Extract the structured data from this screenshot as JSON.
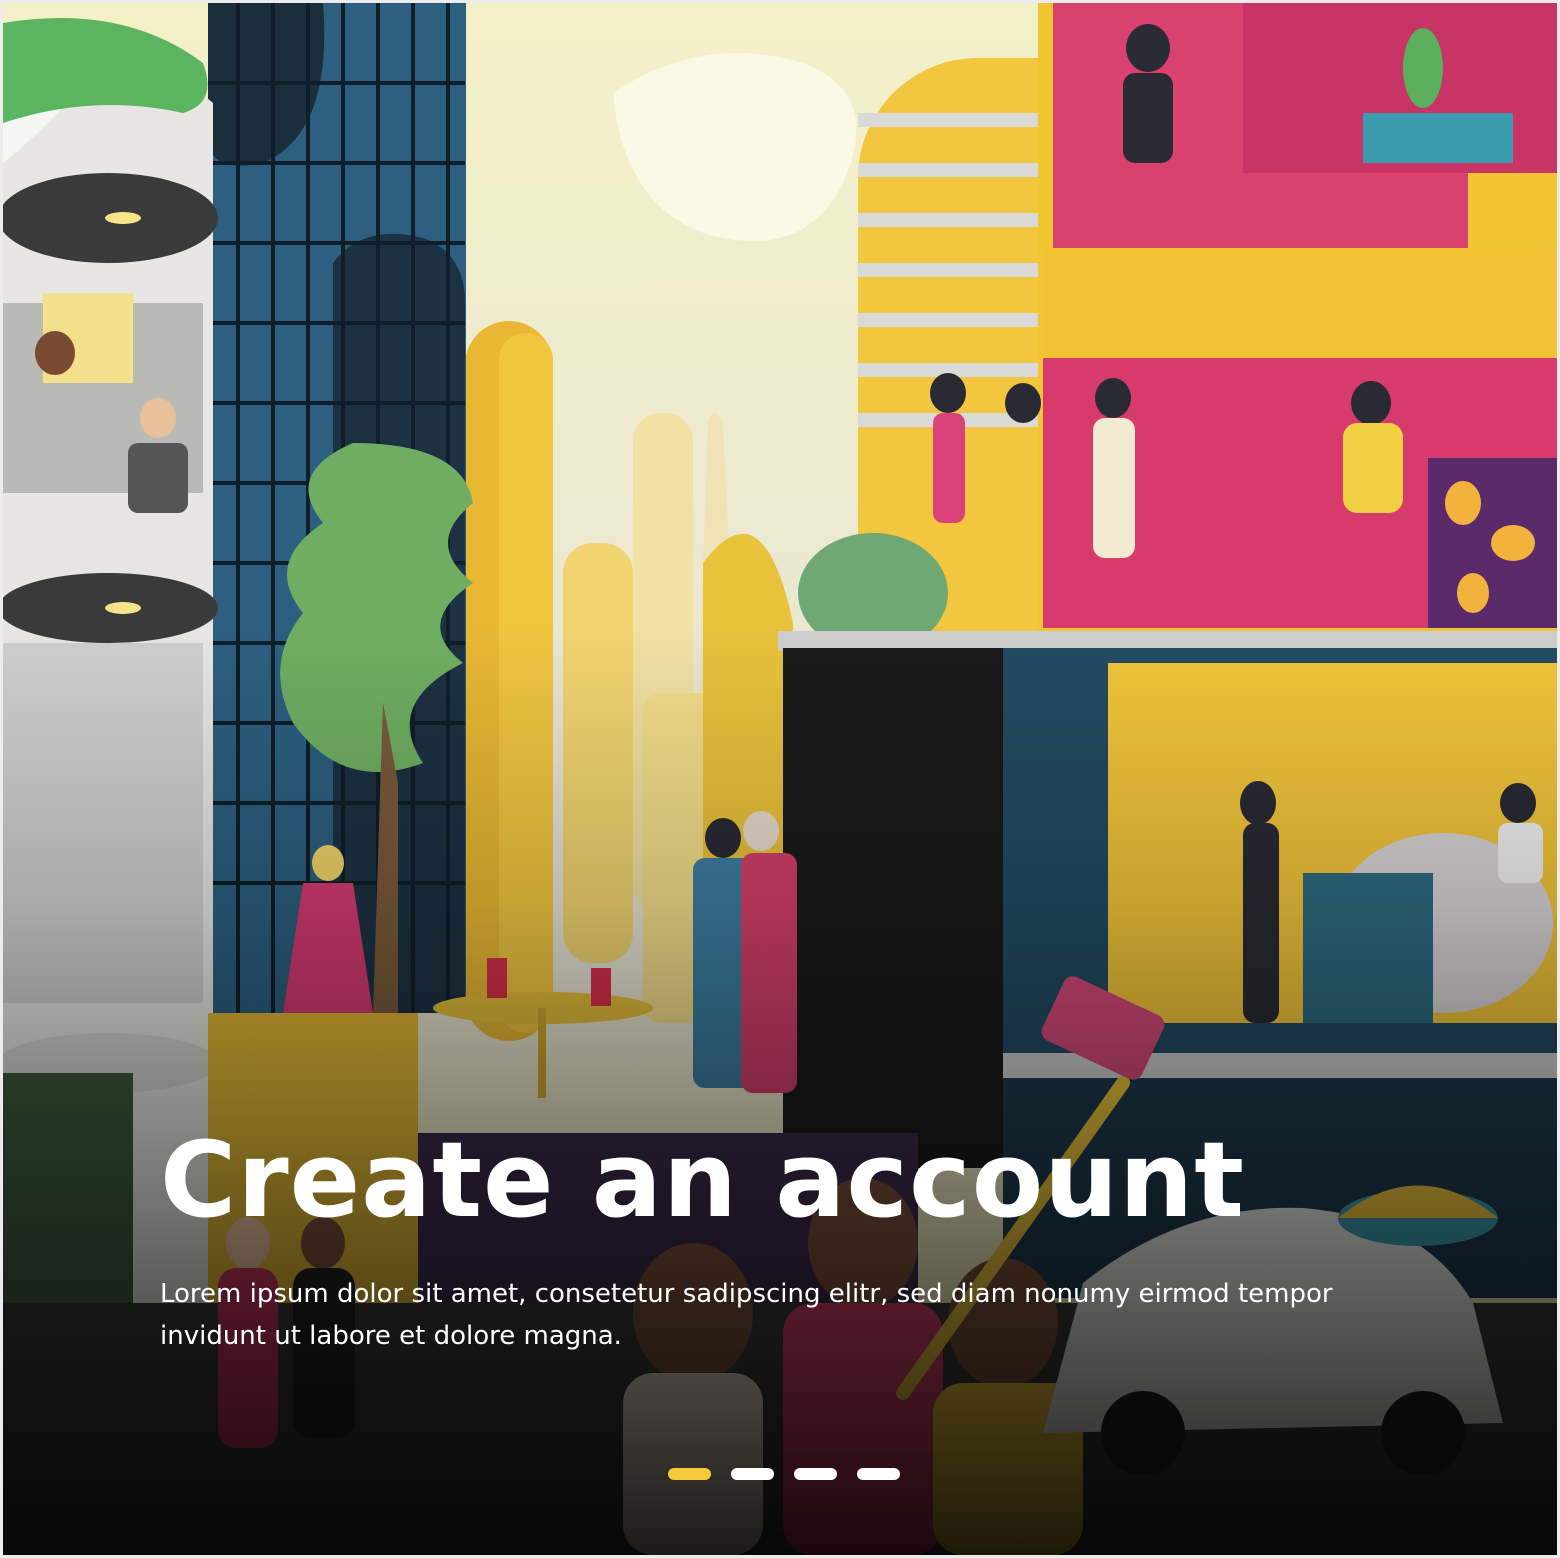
{
  "slide": {
    "title": "Create an account",
    "description": "Lorem ipsum dolor sit amet, consetetur sadipscing elitr, sed diam nonumy eirmod tempor invidunt ut labore et dolore magna."
  },
  "pagination": {
    "total": 4,
    "active_index": 0,
    "active_color": "#f6c83b",
    "inactive_color": "#ffffff"
  },
  "illustration": {
    "subject": "city-life-illustration",
    "palette": [
      "#f5c842",
      "#d83c6e",
      "#24506a",
      "#6fb56a",
      "#ebe7b0",
      "#1b1b1b"
    ]
  }
}
